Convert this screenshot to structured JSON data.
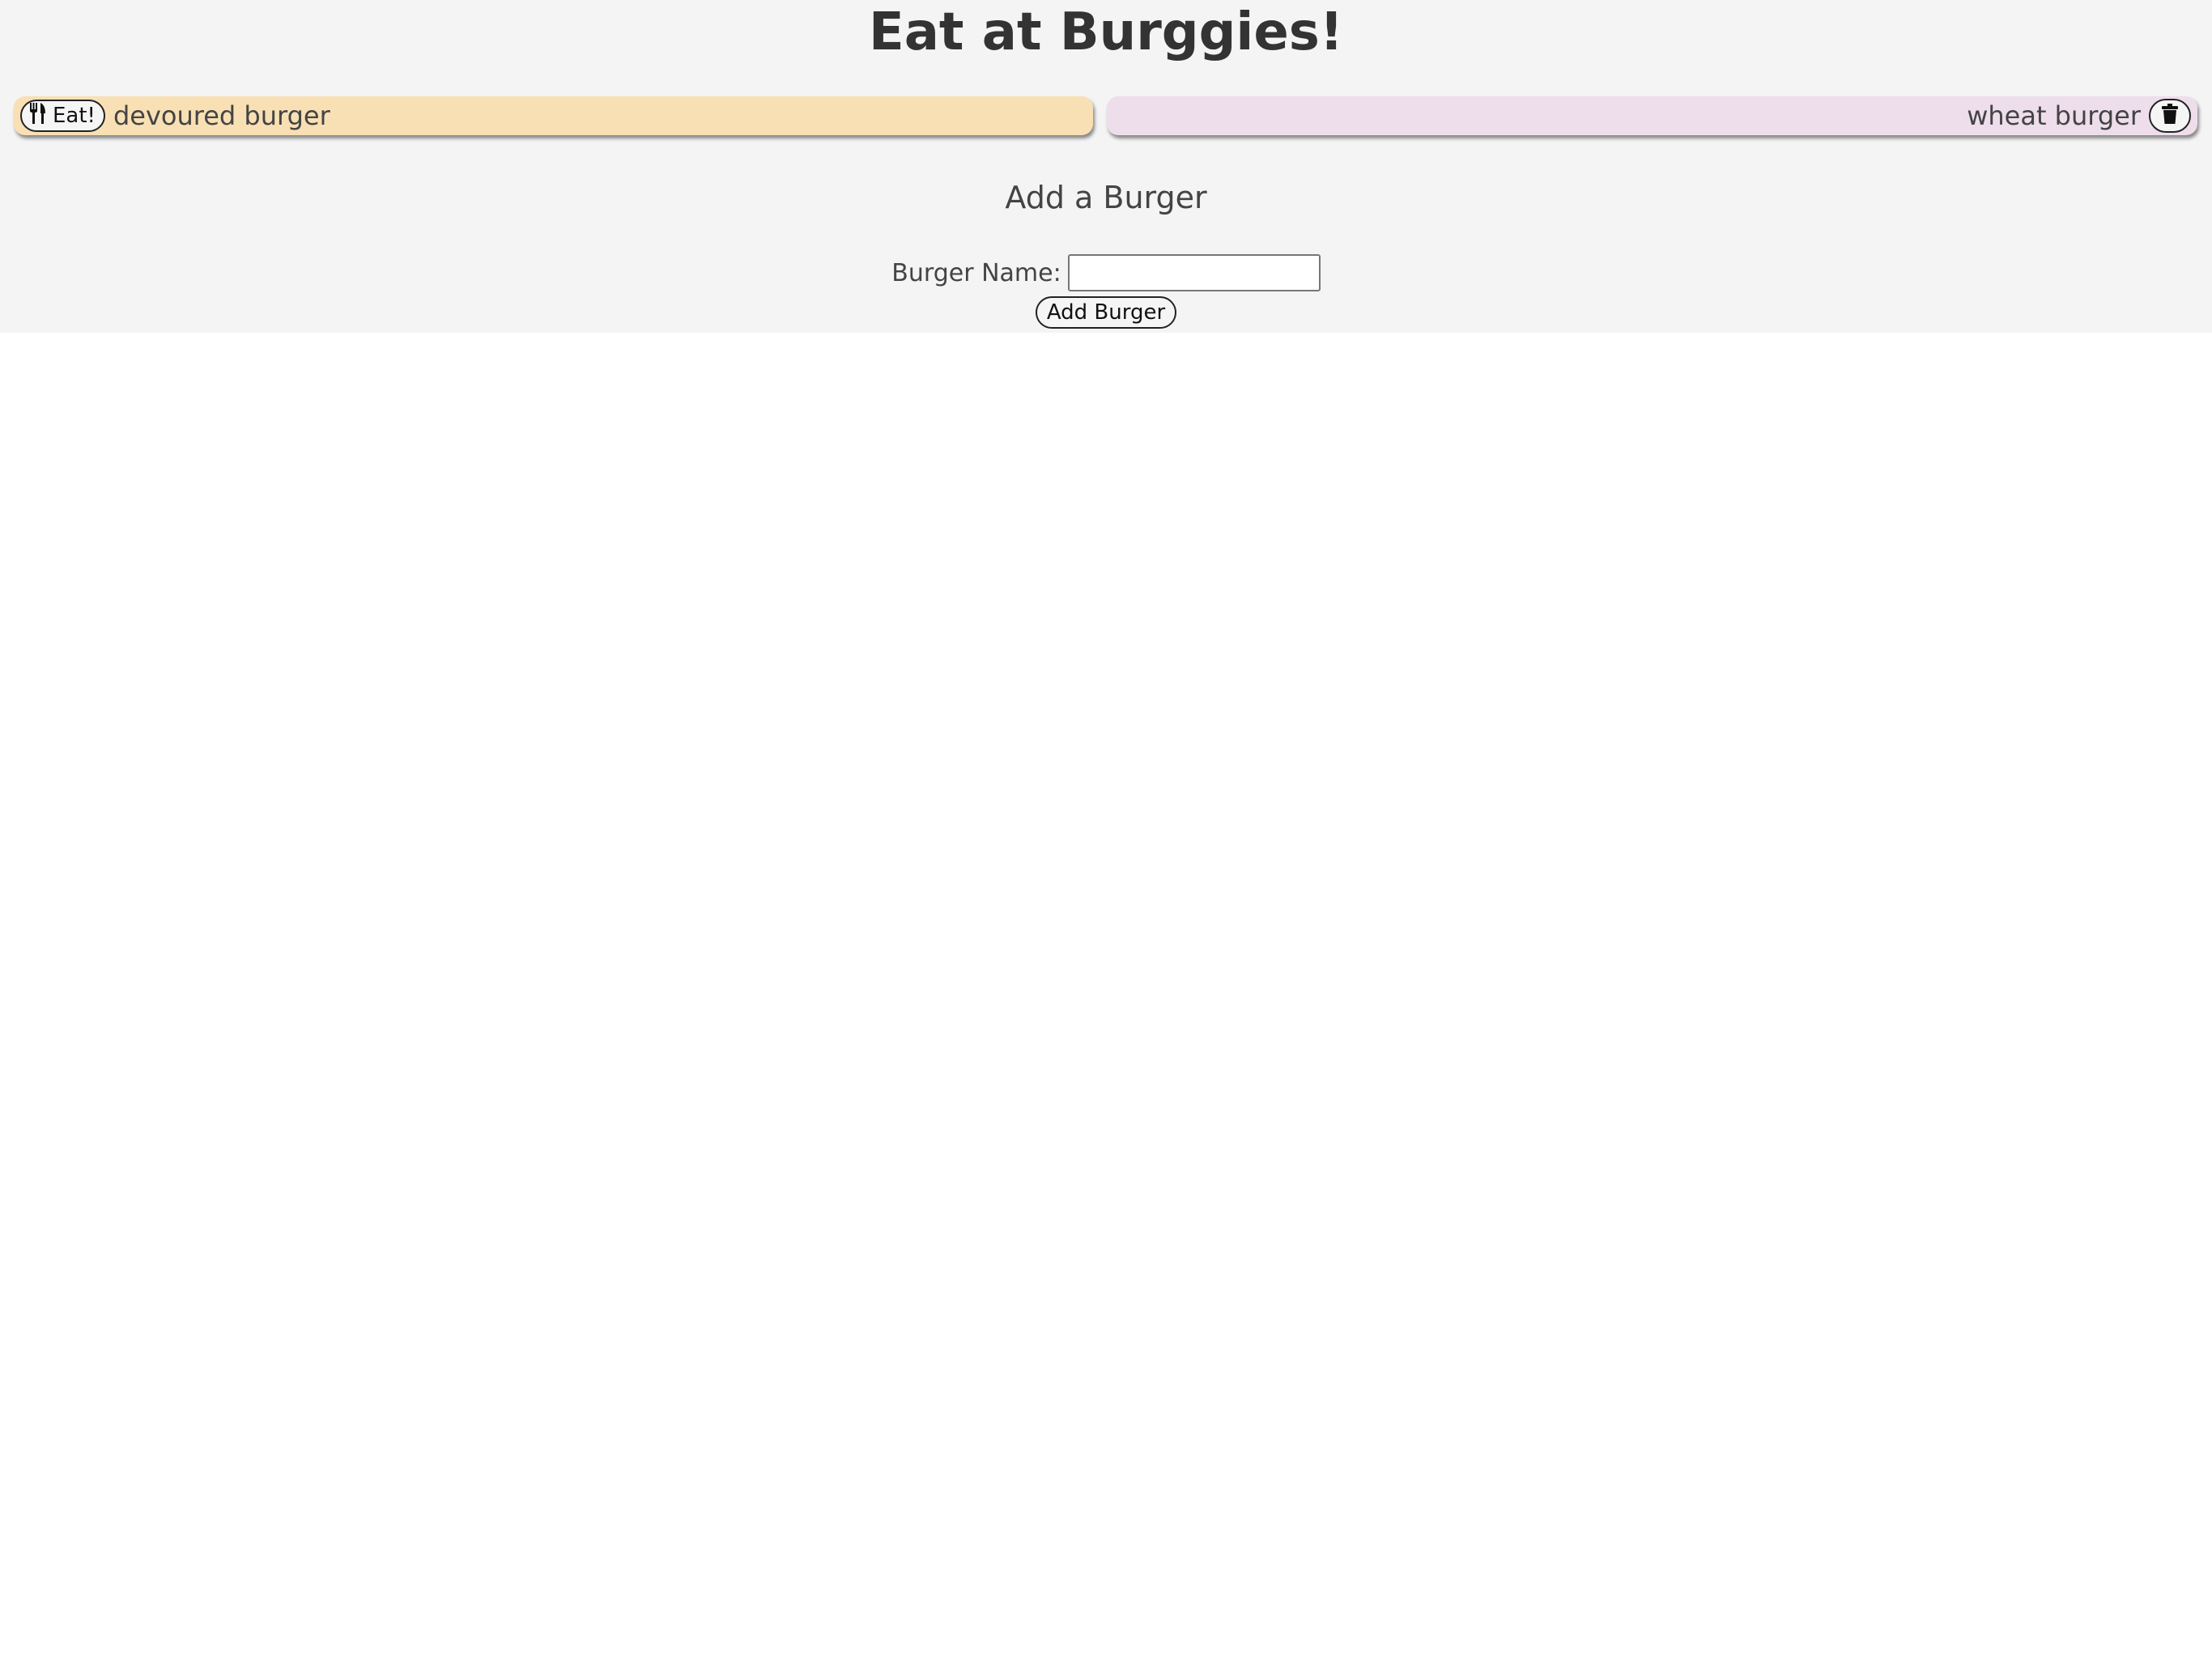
{
  "header": {
    "title": "Eat at Burggies!"
  },
  "uneaten_burgers": [
    {
      "name": "devoured burger",
      "eat_label": "Eat!",
      "icon": "fork-knife-icon"
    }
  ],
  "devoured_burgers": [
    {
      "name": "wheat burger",
      "icon": "trash-icon"
    }
  ],
  "add_form": {
    "heading": "Add a Burger",
    "label": "Burger Name:",
    "input_value": "",
    "placeholder": "",
    "submit_label": "Add Burger"
  },
  "colors": {
    "top_background": "#f4f4f4",
    "uneaten_card": "#f8e0b4",
    "devoured_card": "#eedeec"
  }
}
